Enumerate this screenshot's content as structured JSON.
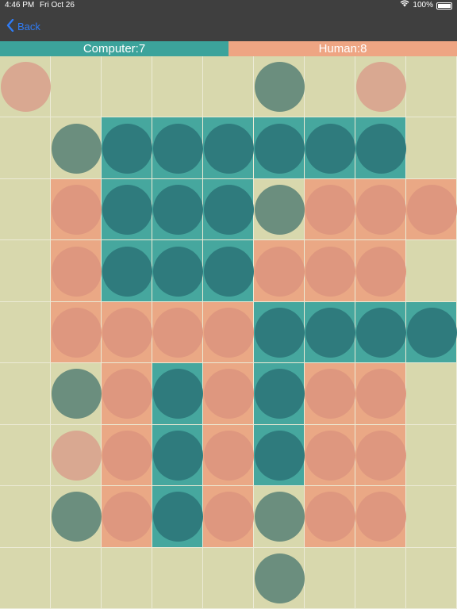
{
  "status_bar": {
    "time": "4:46 PM",
    "date": "Fri Oct 26",
    "battery": "100%"
  },
  "nav": {
    "back_label": "Back"
  },
  "scores": {
    "computer_label": "Computer:7",
    "human_label": "Human:8"
  },
  "colors": {
    "computer_bar": "#3ca39b",
    "human_bar": "#eea583",
    "board": "#d8d8ad",
    "computer_cell": "#46a79e",
    "human_cell": "#eaa885",
    "computer_disc": "#2f7b7d",
    "human_disc": "#de977f",
    "computer_piece": "#6b8e7e",
    "human_piece": "#d9a891"
  },
  "board": {
    "rows": 9,
    "cols": 9,
    "grid": [
      [
        "h.",
        "..",
        "..",
        "..",
        "..",
        "c.",
        "..",
        "h.",
        ".."
      ],
      [
        "..",
        "c.",
        "cC",
        "cC",
        "cC",
        "cC",
        "cC",
        "cC",
        ".."
      ],
      [
        "..",
        "hH",
        "cC",
        "cC",
        "cC",
        "c.",
        "hH",
        "hH",
        "hH"
      ],
      [
        "..",
        "hH",
        "cC",
        "cC",
        "cC",
        "hH",
        "hH",
        "hH",
        ".."
      ],
      [
        "..",
        "hH",
        "hH",
        "hH",
        "hH",
        "cC",
        "cC",
        "cC",
        "cC"
      ],
      [
        "..",
        "c.",
        "hH",
        "cC",
        "hH",
        "cC",
        "hH",
        "hH",
        ".."
      ],
      [
        "..",
        "h.",
        "hH",
        "cC",
        "hH",
        "cC",
        "hH",
        "hH",
        ".."
      ],
      [
        "..",
        "c.",
        "hH",
        "cC",
        "hH",
        "c.",
        "hH",
        "hH",
        ".."
      ],
      [
        "..",
        "..",
        "..",
        "..",
        "..",
        "c.",
        "..",
        "..",
        ".."
      ]
    ]
  }
}
